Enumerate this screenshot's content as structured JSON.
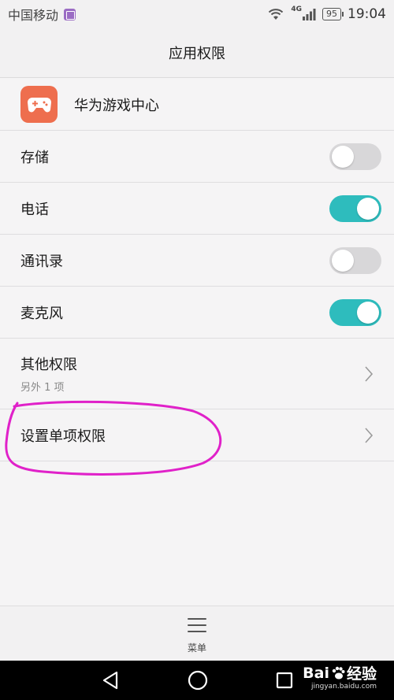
{
  "status_bar": {
    "carrier": "中国移动",
    "network": "4G",
    "battery": "95",
    "time": "19:04"
  },
  "header": {
    "title": "应用权限"
  },
  "app": {
    "name": "华为游戏中心",
    "icon": "gamepad-icon",
    "icon_color": "#ee6e4e"
  },
  "permissions": [
    {
      "label": "存储",
      "enabled": false
    },
    {
      "label": "电话",
      "enabled": true
    },
    {
      "label": "通讯录",
      "enabled": false
    },
    {
      "label": "麦克风",
      "enabled": true
    }
  ],
  "other_permissions": {
    "label": "其他权限",
    "sub": "另外 1 项"
  },
  "single_permission": {
    "label": "设置单项权限"
  },
  "bottom_bar": {
    "menu_label": "菜单"
  },
  "watermark": {
    "brand_a": "Bai",
    "brand_b": "经验",
    "url": "jingyan.baidu.com"
  },
  "colors": {
    "toggle_on": "#2ebcbd",
    "toggle_off": "#d8d7d9",
    "annotation": "#e021c9"
  }
}
